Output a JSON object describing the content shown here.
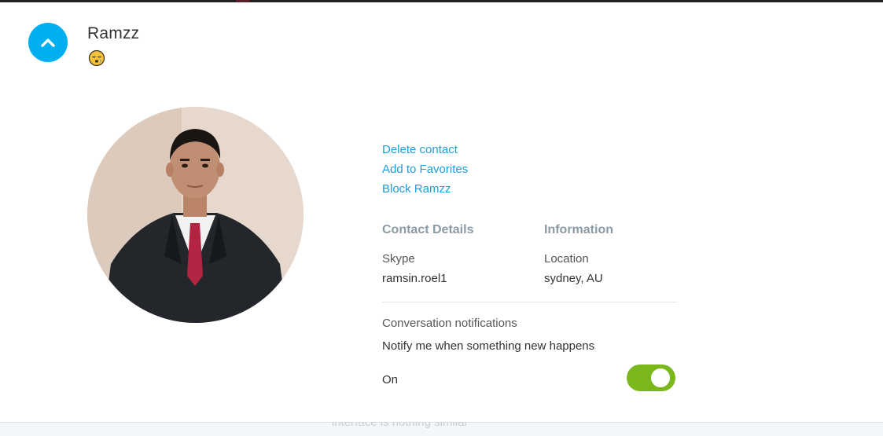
{
  "header": {
    "contact_name": "Ramzz",
    "mood_icon": "sleepy-face-emoji-icon",
    "collapse_icon": "chevron-up-icon"
  },
  "actions": {
    "delete": "Delete contact",
    "favorite": "Add to Favorites",
    "block": "Block Ramzz"
  },
  "contact_details": {
    "title": "Contact Details",
    "skype_label": "Skype",
    "skype_value": "ramsin.roel1"
  },
  "information": {
    "title": "Information",
    "location_label": "Location",
    "location_value": "sydney, AU"
  },
  "notifications": {
    "title": "Conversation notifications",
    "description": "Notify me when something new happens",
    "state_label": "On",
    "enabled": true
  },
  "background": {
    "partial_text": "interface is nothing similar"
  },
  "colors": {
    "accent": "#00aff0",
    "link": "#1aa0d8",
    "toggle_on": "#7ab81e",
    "section_title": "#8a9ba6"
  }
}
